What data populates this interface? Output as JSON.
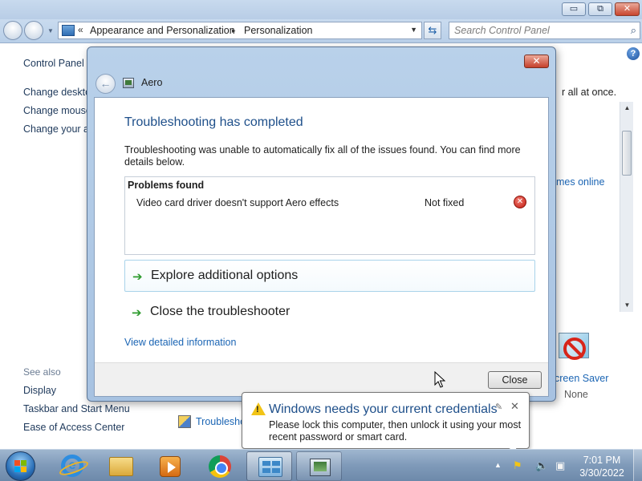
{
  "window": {
    "minimize_glyph": "▭",
    "maximize_glyph": "⧉",
    "close_glyph": "✕"
  },
  "address_bar": {
    "overflow_glyph": "«",
    "crumbs": [
      "Appearance and Personalization",
      "Personalization"
    ],
    "separator": "▸",
    "dropdown_glyph": "▼"
  },
  "search": {
    "placeholder": "Search Control Panel"
  },
  "sidebar": {
    "home_link": "Control Panel Home",
    "links": [
      "Change desktop icons",
      "Change mouse pointers",
      "Change your account picture"
    ],
    "see_also_heading": "See also",
    "see_also": [
      "Display",
      "Taskbar and Start Menu",
      "Ease of Access Center"
    ]
  },
  "main": {
    "right_text": "r all at once.",
    "themes_link": "mes online",
    "screen_saver_label": "creen Saver",
    "screen_saver_value": "None",
    "troubleshoot_link": "Troubleshoot problems with transparency and other Aero effects"
  },
  "dialog": {
    "title": "Aero",
    "close_glyph": "✕",
    "back_glyph": "←",
    "heading": "Troubleshooting has completed",
    "message": "Troubleshooting was unable to automatically fix all of the issues found. You can find more details below.",
    "problems_header": "Problems found",
    "problem_name": "Video card driver doesn't support Aero effects",
    "problem_status": "Not fixed",
    "error_glyph": "✕",
    "option_explore": "Explore additional options",
    "option_close": "Close the troubleshooter",
    "option_arrow": "➔",
    "view_details": "View detailed information",
    "close_button": "Close"
  },
  "balloon": {
    "title": "Windows needs your current credentials",
    "text": "Please lock this computer, then unlock it using your most recent password or smart card.",
    "warn_glyph": "!",
    "pin_glyph": "✎",
    "close_glyph": "✕"
  },
  "taskbar": {
    "apps": [
      "internet-explorer-icon",
      "windows-explorer-icon",
      "media-player-icon",
      "chrome-icon",
      "control-panel-icon",
      "aero-troubleshooter-icon"
    ],
    "tray_arrow": "▲",
    "clock_time": "7:01 PM",
    "clock_date": "3/30/2022"
  },
  "colors": {
    "link": "#1b65b4",
    "heading": "#1e4f8a",
    "error": "#c01a10",
    "warning": "#f2c416",
    "success_arrow": "#2e9b2e"
  }
}
